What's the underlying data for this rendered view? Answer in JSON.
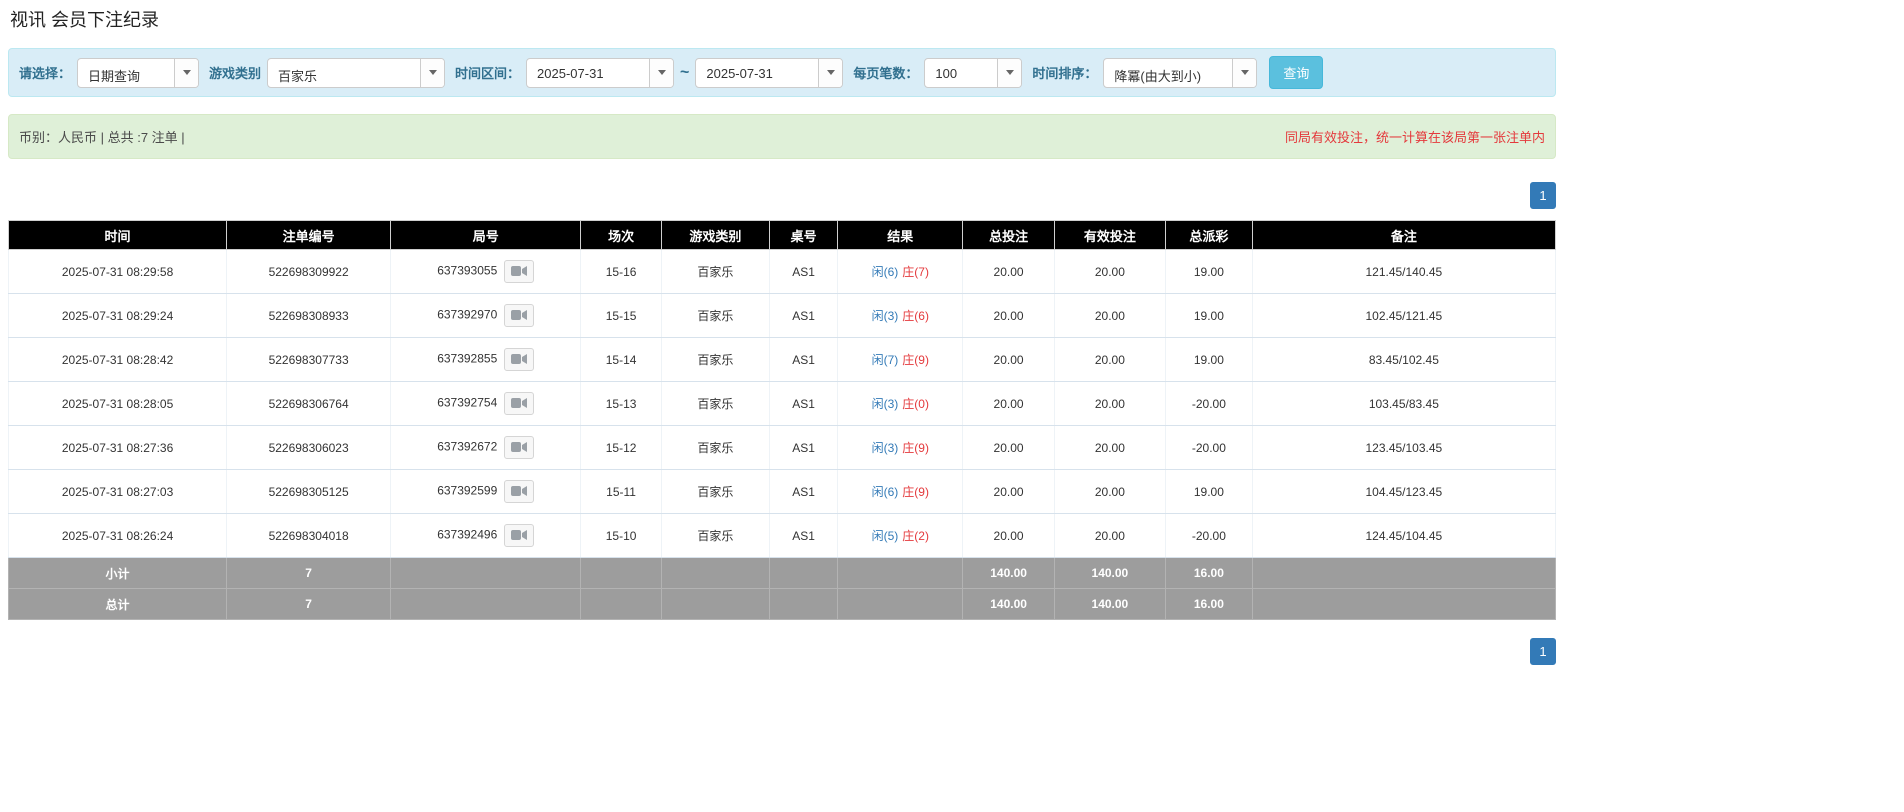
{
  "page": {
    "title": "视讯 会员下注纪录"
  },
  "filters": {
    "select_label": "请选择：",
    "select_value": "日期查询",
    "game_type_label": "游戏类别",
    "game_type_value": "百家乐",
    "date_range_label": "时间区间：",
    "date_from": "2025-07-31",
    "date_separator": "~",
    "date_to": "2025-07-31",
    "page_size_label": "每页笔数：",
    "page_size_value": "100",
    "sort_label": "时间排序：",
    "sort_value": "降冪(由大到小)",
    "search_button": "查询"
  },
  "summary": {
    "left": "币别：人民币 | 总共 :7 注单 |",
    "right": "同局有效投注，统一计算在该局第一张注单内"
  },
  "pagination": {
    "page": "1"
  },
  "table": {
    "headers": [
      "时间",
      "注单编号",
      "局号",
      "场次",
      "游戏类别",
      "桌号",
      "结果",
      "总投注",
      "有效投注",
      "总派彩",
      "备注"
    ],
    "rows": [
      {
        "time": "2025-07-31 08:29:58",
        "bet_id": "522698309922",
        "round_id": "637393055",
        "session": "15-16",
        "game_type": "百家乐",
        "table_no": "AS1",
        "result_player": "闲(6)",
        "result_banker": "庄(7)",
        "total_bet": "20.00",
        "valid_bet": "20.00",
        "payout": "19.00",
        "remark": "121.45/140.45"
      },
      {
        "time": "2025-07-31 08:29:24",
        "bet_id": "522698308933",
        "round_id": "637392970",
        "session": "15-15",
        "game_type": "百家乐",
        "table_no": "AS1",
        "result_player": "闲(3)",
        "result_banker": "庄(6)",
        "total_bet": "20.00",
        "valid_bet": "20.00",
        "payout": "19.00",
        "remark": "102.45/121.45"
      },
      {
        "time": "2025-07-31 08:28:42",
        "bet_id": "522698307733",
        "round_id": "637392855",
        "session": "15-14",
        "game_type": "百家乐",
        "table_no": "AS1",
        "result_player": "闲(7)",
        "result_banker": "庄(9)",
        "total_bet": "20.00",
        "valid_bet": "20.00",
        "payout": "19.00",
        "remark": "83.45/102.45"
      },
      {
        "time": "2025-07-31 08:28:05",
        "bet_id": "522698306764",
        "round_id": "637392754",
        "session": "15-13",
        "game_type": "百家乐",
        "table_no": "AS1",
        "result_player": "闲(3)",
        "result_banker": "庄(0)",
        "total_bet": "20.00",
        "valid_bet": "20.00",
        "payout": "-20.00",
        "remark": "103.45/83.45"
      },
      {
        "time": "2025-07-31 08:27:36",
        "bet_id": "522698306023",
        "round_id": "637392672",
        "session": "15-12",
        "game_type": "百家乐",
        "table_no": "AS1",
        "result_player": "闲(3)",
        "result_banker": "庄(9)",
        "total_bet": "20.00",
        "valid_bet": "20.00",
        "payout": "-20.00",
        "remark": "123.45/103.45"
      },
      {
        "time": "2025-07-31 08:27:03",
        "bet_id": "522698305125",
        "round_id": "637392599",
        "session": "15-11",
        "game_type": "百家乐",
        "table_no": "AS1",
        "result_player": "闲(6)",
        "result_banker": "庄(9)",
        "total_bet": "20.00",
        "valid_bet": "20.00",
        "payout": "19.00",
        "remark": "104.45/123.45"
      },
      {
        "time": "2025-07-31 08:26:24",
        "bet_id": "522698304018",
        "round_id": "637392496",
        "session": "15-10",
        "game_type": "百家乐",
        "table_no": "AS1",
        "result_player": "闲(5)",
        "result_banker": "庄(2)",
        "total_bet": "20.00",
        "valid_bet": "20.00",
        "payout": "-20.00",
        "remark": "124.45/104.45"
      }
    ],
    "subtotal": {
      "label": "小计",
      "count": "7",
      "total_bet": "140.00",
      "valid_bet": "140.00",
      "payout": "16.00"
    },
    "total": {
      "label": "总计",
      "count": "7",
      "total_bet": "140.00",
      "valid_bet": "140.00",
      "payout": "16.00"
    }
  },
  "colors": {
    "accent_blue": "#337ab7",
    "negative_red": "#e4393c",
    "filter_bg": "#d9edf7",
    "summary_bg": "#dff0d8",
    "header_bg": "#000000",
    "total_row_bg": "#9d9d9d"
  }
}
